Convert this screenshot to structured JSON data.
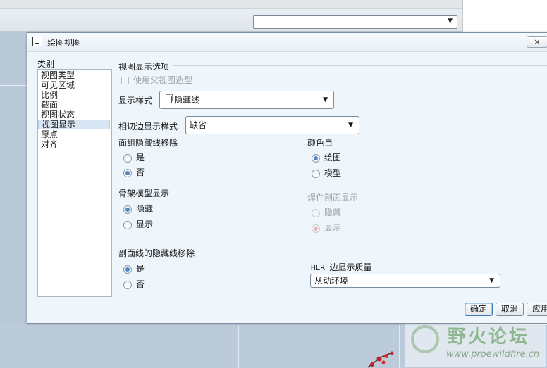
{
  "dialog": {
    "title": "绘图视图",
    "close_label": "×"
  },
  "categories": {
    "label": "类别",
    "items": [
      "视图类型",
      "可见区域",
      "比例",
      "截面",
      "视图状态",
      "视图显示",
      "原点",
      "对齐"
    ],
    "selected_index": 5
  },
  "options": {
    "group_title": "视图显示选项",
    "use_parent_label": "使用父视图造型",
    "use_parent_checked": false,
    "display_style_label": "显示样式",
    "display_style_value": "隐藏线",
    "display_style_icon": "hidden-line-icon",
    "tangent_label": "相切边显示样式",
    "tangent_value": "缺省",
    "face_group_label": "面组隐藏线移除",
    "face_group_yes": "是",
    "face_group_no": "否",
    "face_group_selected": "否",
    "skeleton_label": "骨架模型显示",
    "skeleton_hide": "隐藏",
    "skeleton_show": "显示",
    "skeleton_selected": "隐藏",
    "section_hlr_label": "剖面线的隐藏线移除",
    "section_yes": "是",
    "section_no": "否",
    "section_selected": "是",
    "color_from_label": "颜色自",
    "color_drawing": "绘图",
    "color_model": "模型",
    "color_selected": "绘图",
    "weld_label": "焊件剖面显示",
    "weld_hide": "隐藏",
    "weld_show": "显示",
    "weld_selected": "显示",
    "hlr_prefix": "HLR",
    "hlr_label": "边显示质量",
    "hlr_value": "从动环境"
  },
  "buttons": {
    "ok": "确定",
    "cancel": "取消",
    "apply": "应用"
  },
  "watermark": {
    "name": "野火论坛",
    "url": "www.proewildfire.cn"
  },
  "colors": {
    "radio_selected": "#4f86c6",
    "dialog_bg": "#eef5fb"
  }
}
